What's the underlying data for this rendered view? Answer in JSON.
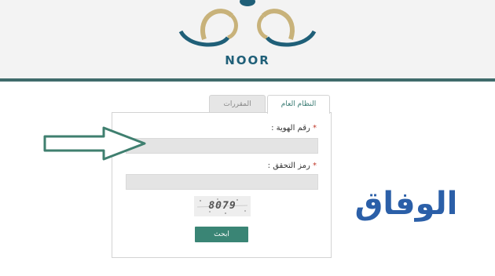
{
  "logo": {
    "text": "NOOR"
  },
  "tabs": [
    {
      "label": "النظام العام",
      "active": true
    },
    {
      "label": "المقررات",
      "active": false
    }
  ],
  "form": {
    "id_label": "رقم الهوية :",
    "captcha_label": "رمز التحقق :",
    "required_mark": "*",
    "captcha_value": "8079",
    "search_label": "ابحث"
  },
  "watermark": {
    "text": "الوفاق",
    "color": "#2b5fa8"
  },
  "colors": {
    "accent": "#3a8575",
    "header_line": "#3f6b6b",
    "arrow": "#3f7f6f"
  },
  "icons": {
    "pointer": "right-arrow-icon"
  }
}
